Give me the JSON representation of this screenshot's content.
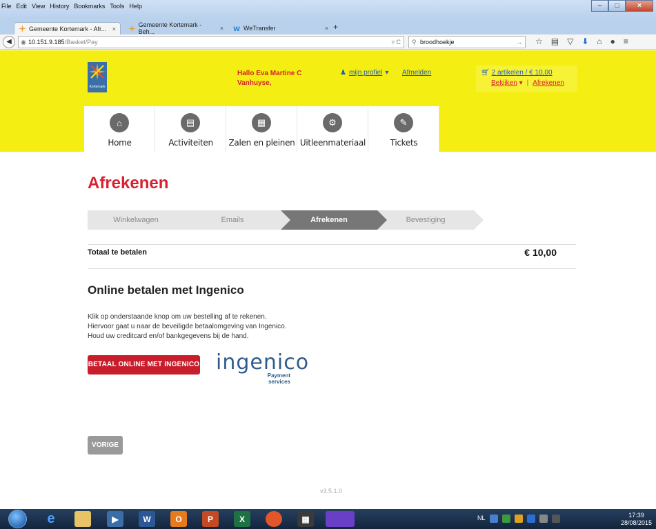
{
  "browser": {
    "menu": [
      "File",
      "Edit",
      "View",
      "History",
      "Bookmarks",
      "Tools",
      "Help"
    ],
    "tabs": [
      {
        "title": "Gemeente Kortemark - Afr..."
      },
      {
        "title": "Gemeente Kortemark - Beh..."
      },
      {
        "title": "WeTransfer"
      }
    ],
    "tab_close": "×",
    "new_tab": "+",
    "url_host": "10.151.9.185",
    "url_path": "/Basket/Pay",
    "search_value": "broodhoekje"
  },
  "header": {
    "logo_text": "Kortemark",
    "greeting": "Hallo Eva Martine C Vanhuyse,",
    "profile_label": "mijn profiel",
    "logout_label": "Afmelden",
    "cart_summary": "2 artikelen / € 10,00",
    "cart_view": "Bekijken",
    "cart_sep": "|",
    "cart_checkout": "Afrekenen"
  },
  "nav": [
    {
      "label": "Home",
      "icon": "home-icon"
    },
    {
      "label": "Activiteiten",
      "icon": "clapper-icon"
    },
    {
      "label": "Zalen en pleinen",
      "icon": "building-icon"
    },
    {
      "label": "Uitleenmateriaal",
      "icon": "gear-icon"
    },
    {
      "label": "Tickets",
      "icon": "ticket-icon"
    }
  ],
  "page": {
    "title": "Afrekenen",
    "steps": [
      "Winkelwagen",
      "Emails",
      "Afrekenen",
      "Bevestiging"
    ],
    "active_step": 2,
    "total_label": "Totaal te betalen",
    "total_value": "€ 10,00",
    "online_heading": "Online betalen met Ingenico",
    "description": "Klik op onderstaande knop om uw bestelling af te rekenen. Hiervoor gaat u naar de beveiligde betaalomgeving van Ingenico. Houd uw creditcard en/of bankgegevens bij de hand.",
    "pay_button": "BETAAL ONLINE MET INGENICO",
    "ingenico_word": "ingenico",
    "ingenico_sub": "Payment services",
    "prev_button": "VORIGE",
    "version": "v3.5.1.0"
  },
  "taskbar": {
    "lang": "NL",
    "time": "17:39",
    "date": "28/08/2015"
  },
  "colors": {
    "header_yellow": "#f4ee12",
    "accent_red": "#d7202f",
    "link_blue": "#1a5cc8"
  }
}
